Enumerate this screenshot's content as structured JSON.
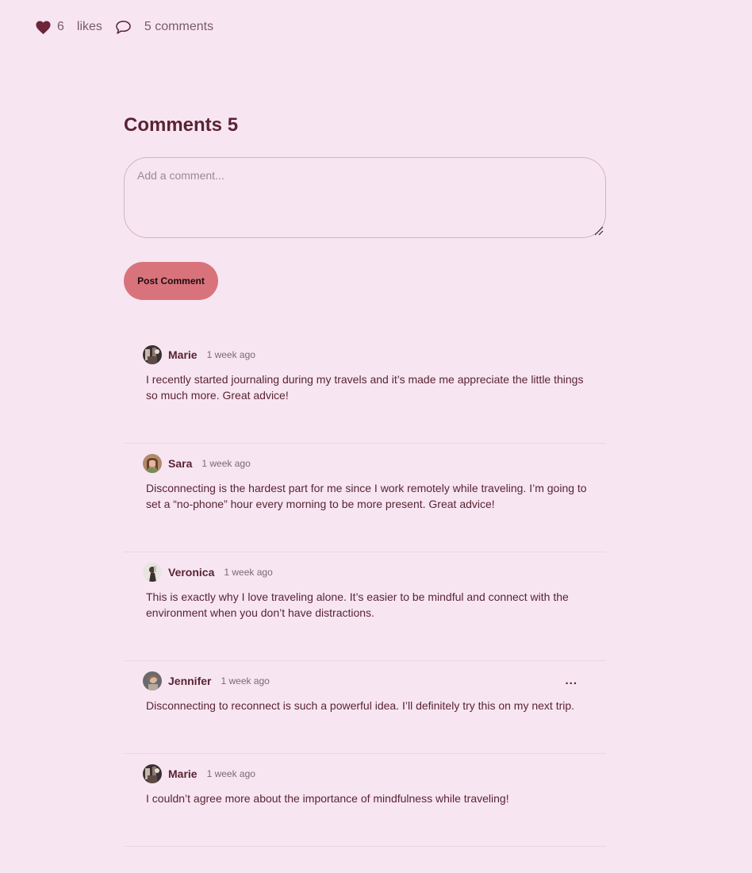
{
  "stats": {
    "likes_count": "6",
    "likes_label": "likes",
    "comments_label": "5 comments"
  },
  "comments_section": {
    "title": "Comments 5",
    "input_placeholder": "Add a comment...",
    "post_button_label": "Post Comment"
  },
  "comments": [
    {
      "author": "Marie",
      "time": "1 week ago",
      "text": "I recently started journaling during my travels and it’s made me appreciate the little things so much more. Great advice!"
    },
    {
      "author": "Sara",
      "time": "1 week ago",
      "text": "Disconnecting is the hardest part for me since I work remotely while traveling. I’m going to set a “no-phone” hour every morning to be more present. Great advice!"
    },
    {
      "author": "Veronica",
      "time": "1 week ago",
      "text": "This is exactly why I love traveling alone. It’s easier to be mindful and connect with the environment when you don’t have distractions."
    },
    {
      "author": "Jennifer",
      "time": "1 week ago",
      "more_label": "...",
      "text": "Disconnecting to reconnect is such a powerful idea. I’ll definitely try this on my next trip."
    },
    {
      "author": "Marie",
      "time": "1 week ago",
      "text": "I couldn’t agree more about the importance of mindfulness while traveling!"
    }
  ],
  "icons": {
    "like": "heart-icon",
    "comment": "speech-bubble-icon",
    "more": "more-options-icon"
  },
  "colors": {
    "background": "#f7e6f1",
    "text": "#5a2334",
    "button": "#d9737b",
    "heart": "#6b2638"
  }
}
